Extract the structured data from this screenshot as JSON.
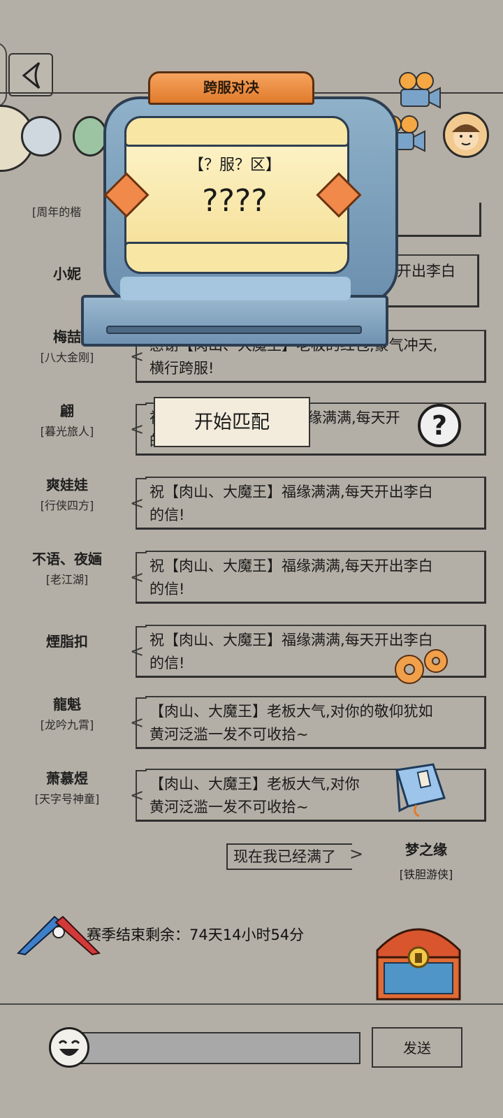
{
  "modal": {
    "title": "跨服对决",
    "server": "【？服？区】",
    "code": "????",
    "match_button": "开始匹配"
  },
  "chat": [
    {
      "name": "",
      "title": "[周年的楷",
      "lines": [
        "",
        ""
      ]
    },
    {
      "name": "小妮",
      "title": "",
      "lines": [
        "每天开出李白"
      ]
    },
    {
      "name": "梅喆",
      "title": "[八大金刚]",
      "lines": [
        "感谢【肉山、大魔王】老板的红包,豪气冲天,",
        "横行跨服!"
      ]
    },
    {
      "name": "翩",
      "title": "[暮光旅人]",
      "lines": [
        "祝",
        "缘满满,每天开",
        "的"
      ]
    },
    {
      "name": "爽娃娃",
      "title": "[行侠四方]",
      "lines": [
        "祝【肉山、大魔王】福缘满满,每天开出李白",
        "的信!"
      ]
    },
    {
      "name": "不语、夜婳",
      "title": "[老江湖]",
      "lines": [
        "祝【肉山、大魔王】福缘满满,每天开出李白",
        "的信!"
      ]
    },
    {
      "name": "煙脂扣",
      "title": "",
      "lines": [
        "祝【肉山、大魔王】福缘满满,每天开出李白",
        "的信!"
      ]
    },
    {
      "name": "龍魁",
      "title": "[龙吟九霄]",
      "lines": [
        "【肉山、大魔王】老板大气,对你的敬仰犹如",
        "黄河泛滥一发不可收拾~"
      ]
    },
    {
      "name": "萧慕煜",
      "title": "[天字号神童]",
      "lines": [
        "【肉山、大魔王】老板大气,对你",
        "黄河泛滥一发不可收拾~"
      ]
    }
  ],
  "me": {
    "message": "现在我已经满了",
    "name": "梦之缘",
    "title": "[铁胆游侠]"
  },
  "season": {
    "text": "赛季结束剩余：74天14小时54分"
  },
  "input": {
    "send_label": "发送"
  },
  "icons": {
    "back": "back-arrow-icon",
    "camera": "video-camera-icon",
    "help": "help-icon",
    "gears": "gears-icon",
    "book": "book-icon",
    "chest": "treasure-chest-icon",
    "emoji": "emoji-icon",
    "vs": "crossed-swords-icon"
  },
  "colors": {
    "background": "#b4afa6",
    "accent": "#e07b2c",
    "panel": "#6b8fae"
  }
}
